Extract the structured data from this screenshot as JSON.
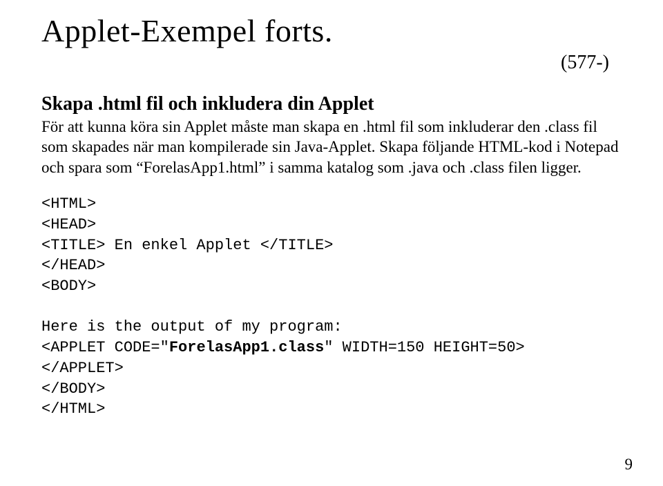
{
  "title": "Applet-Exempel forts.",
  "page_ref": "(577-)",
  "subhead": "Skapa .html fil och inkludera din Applet",
  "body": "För att kunna köra sin Applet måste man skapa en .html fil som inkluderar den .class fil som skapades när man kompilerade sin Java-Applet. Skapa följande HTML-kod i Notepad och spara som “ForelasApp1.html” i samma katalog som .java och .class filen ligger.",
  "code": {
    "l1": "<HTML>",
    "l2": "<HEAD>",
    "l3": "<TITLE> En enkel Applet </TITLE>",
    "l4": "</HEAD>",
    "l5": "<BODY>",
    "l6": "",
    "l7": "Here is the output of my program:",
    "l8a": "<APPLET CODE=\"",
    "l8b": "ForelasApp1.class",
    "l8c": "\" WIDTH=150 HEIGHT=50>",
    "l9": "</APPLET>",
    "l10": "</BODY>",
    "l11": "</HTML>"
  },
  "page_number": "9"
}
